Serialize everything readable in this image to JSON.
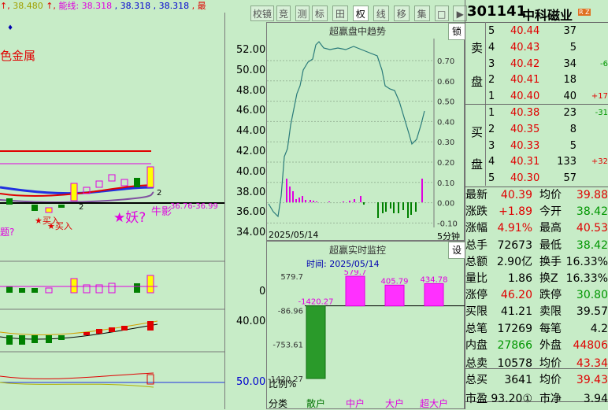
{
  "header": {
    "ma_text_1": "38.480",
    "ma_prefix_red": "↑,",
    "ma_label_energy": "能线:",
    "ma_energy_val": "38.318",
    "ma_val_2": "38.318",
    "ma_val_3": "38.318",
    "ma_trunc": "最",
    "sector_name": "色金属",
    "note_icon": "♦"
  },
  "toolbar": {
    "buttons": [
      "校镜",
      "竞",
      "测",
      "标",
      "田",
      "权",
      "线",
      "移",
      "集",
      "□",
      "▶"
    ],
    "active_index": 5
  },
  "price_axis": [
    "52.00",
    "50.00",
    "48.00",
    "46.00",
    "44.00",
    "42.00",
    "40.00",
    "38.00",
    "36.00",
    "34.00"
  ],
  "main_chart": {
    "annotation_buy": "买入",
    "annotation_buy2": "买入",
    "annotation_demon": "★妖?",
    "annotation_shadow": "牛影",
    "annotation_range": "36.76-36.99",
    "annotation_q": "题?",
    "marker_2a": "2",
    "marker_2b": "2"
  },
  "sub_axis": {
    "vol_zero": "0",
    "macd_val": "40.00",
    "ratio_val": "50.00",
    "ratio_label": "比例%",
    "class_label": "分类"
  },
  "trend_panel": {
    "title": "超赢盘中趋势",
    "lock_btn": "锁",
    "date": "2025/05/14",
    "interval": "5分钟",
    "ticks": [
      "0.70",
      "0.60",
      "0.50",
      "0.40",
      "0.30",
      "0.20",
      "0.10",
      "0.00",
      "-0.10"
    ]
  },
  "monitor_panel": {
    "title": "超赢实时监控",
    "settings_btn": "设",
    "time_label": "时间:",
    "date": "2025/05/14",
    "axis": [
      "579.7",
      "-86.96",
      "-753.61",
      "-1420.27"
    ],
    "bars": [
      {
        "label": "散户",
        "value": -1420.27,
        "display": "-1420.27"
      },
      {
        "label": "中户",
        "value": 579.7,
        "display": "579.7"
      },
      {
        "label": "大户",
        "value": 405.79,
        "display": "405.79"
      },
      {
        "label": "超大户",
        "value": 434.78,
        "display": "434.78"
      }
    ]
  },
  "quote": {
    "code": "301141",
    "name": "中科磁业",
    "badge": "R Z",
    "sell_label_1": "卖",
    "sell_label_2": "盘",
    "buy_label_1": "买",
    "buy_label_2": "盘",
    "asks": [
      {
        "level": "5",
        "price": "40.44",
        "vol": "37",
        "chg": ""
      },
      {
        "level": "4",
        "price": "40.43",
        "vol": "5",
        "chg": ""
      },
      {
        "level": "3",
        "price": "40.42",
        "vol": "34",
        "chg": "-6"
      },
      {
        "level": "2",
        "price": "40.41",
        "vol": "18",
        "chg": ""
      },
      {
        "level": "1",
        "price": "40.40",
        "vol": "40",
        "chg": "+17"
      }
    ],
    "bids": [
      {
        "level": "1",
        "price": "40.38",
        "vol": "23",
        "chg": "-31"
      },
      {
        "level": "2",
        "price": "40.35",
        "vol": "8",
        "chg": ""
      },
      {
        "level": "3",
        "price": "40.33",
        "vol": "5",
        "chg": ""
      },
      {
        "level": "4",
        "price": "40.31",
        "vol": "133",
        "chg": "+32"
      },
      {
        "level": "5",
        "price": "40.30",
        "vol": "57",
        "chg": ""
      }
    ]
  },
  "stats": [
    {
      "l1": "最新",
      "v1": "40.39",
      "c1": "red",
      "l2": "均价",
      "v2": "39.88",
      "c2": "red"
    },
    {
      "l1": "涨跌",
      "v1": "+1.89",
      "c1": "red",
      "l2": "今开",
      "v2": "38.42",
      "c2": "grn"
    },
    {
      "l1": "涨幅",
      "v1": "4.91%",
      "c1": "red",
      "l2": "最高",
      "v2": "40.53",
      "c2": "red"
    },
    {
      "l1": "总手",
      "v1": "72673",
      "c1": "blk",
      "l2": "最低",
      "v2": "38.42",
      "c2": "grn"
    },
    {
      "l1": "总额",
      "v1": "2.90亿",
      "c1": "blk",
      "l2": "换手",
      "v2": "16.33%",
      "c2": "blk"
    },
    {
      "l1": "量比",
      "v1": "1.86",
      "c1": "blk",
      "l2": "换Z",
      "v2": "16.33%",
      "c2": "blk"
    },
    {
      "l1": "涨停",
      "v1": "46.20",
      "c1": "red",
      "l2": "跌停",
      "v2": "30.80",
      "c2": "grn"
    },
    {
      "l1": "买限",
      "v1": "41.21",
      "c1": "blk",
      "l2": "卖限",
      "v2": "39.57",
      "c2": "blk"
    },
    {
      "l1": "总笔",
      "v1": "17269",
      "c1": "blk",
      "l2": "每笔",
      "v2": "4.2",
      "c2": "blk"
    },
    {
      "l1": "内盘",
      "v1": "27866",
      "c1": "grn",
      "l2": "外盘",
      "v2": "44806",
      "c2": "red"
    },
    {
      "l1": "总卖",
      "v1": "10578",
      "c1": "blk",
      "l2": "均价",
      "v2": "43.34",
      "c2": "red"
    },
    {
      "l1": "总买",
      "v1": "3641",
      "c1": "blk",
      "l2": "均价",
      "v2": "39.43",
      "c2": "red"
    },
    {
      "l1": "市盈",
      "v1": "93.20①",
      "c1": "blk",
      "l2": "市净",
      "v2": "3.94",
      "c2": "blk"
    }
  ],
  "colors": {
    "up": "#e00000",
    "down": "#009600",
    "bg": "#c7ecc7"
  }
}
